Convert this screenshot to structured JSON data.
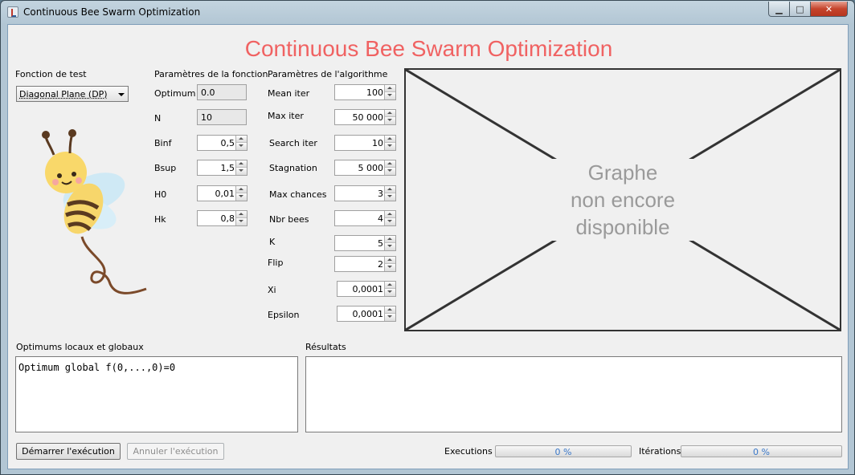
{
  "window": {
    "title": "Continuous Bee Swarm Optimization"
  },
  "window_controls": {
    "minimize": "▁",
    "maximize": "□",
    "close": "✕"
  },
  "header": {
    "title": "Continuous Bee Swarm Optimization"
  },
  "test_function": {
    "label": "Fonction de test",
    "selected": "Diagonal Plane (DP)"
  },
  "function_params": {
    "label": "Paramètres de la fonction",
    "optimum": {
      "label": "Optimum",
      "value": "0.0"
    },
    "n": {
      "label": "N",
      "value": "10"
    },
    "binf": {
      "label": "Binf",
      "value": "0,5"
    },
    "bsup": {
      "label": "Bsup",
      "value": "1,5"
    },
    "h0": {
      "label": "H0",
      "value": "0,01"
    },
    "hk": {
      "label": "Hk",
      "value": "0,8"
    }
  },
  "algo_params": {
    "label": "Paramètres de l'algorithme",
    "mean_iter": {
      "label": "Mean iter",
      "value": "100"
    },
    "max_iter": {
      "label": "Max iter",
      "value": "50 000"
    },
    "search_iter": {
      "label": "Search iter",
      "value": "10"
    },
    "stagnation": {
      "label": "Stagnation",
      "value": "5 000"
    },
    "max_chances": {
      "label": "Max chances",
      "value": "3"
    },
    "nbr_bees": {
      "label": "Nbr bees",
      "value": "4"
    },
    "k": {
      "label": "K",
      "value": "5"
    },
    "flip": {
      "label": "Flip",
      "value": "2"
    },
    "xi": {
      "label": "Xi",
      "value": "0,0001"
    },
    "epsilon": {
      "label": "Epsilon",
      "value": "0,0001"
    }
  },
  "graph": {
    "line1": "Graphe",
    "line2": "non encore",
    "line3": "disponible"
  },
  "optimums": {
    "label": "Optimums locaux et globaux",
    "content": "Optimum global f(0,...,0)=0"
  },
  "results": {
    "label": "Résultats",
    "content": ""
  },
  "buttons": {
    "start": "Démarrer l'exécution",
    "cancel": "Annuler l'exécution"
  },
  "executions": {
    "label": "Executions",
    "text": "0 %",
    "progress": 0
  },
  "iterations": {
    "label": "Itérations",
    "text": "0 %",
    "progress": 0
  },
  "colors": {
    "title": "#f06262",
    "progress_text": "#3a78c9"
  }
}
